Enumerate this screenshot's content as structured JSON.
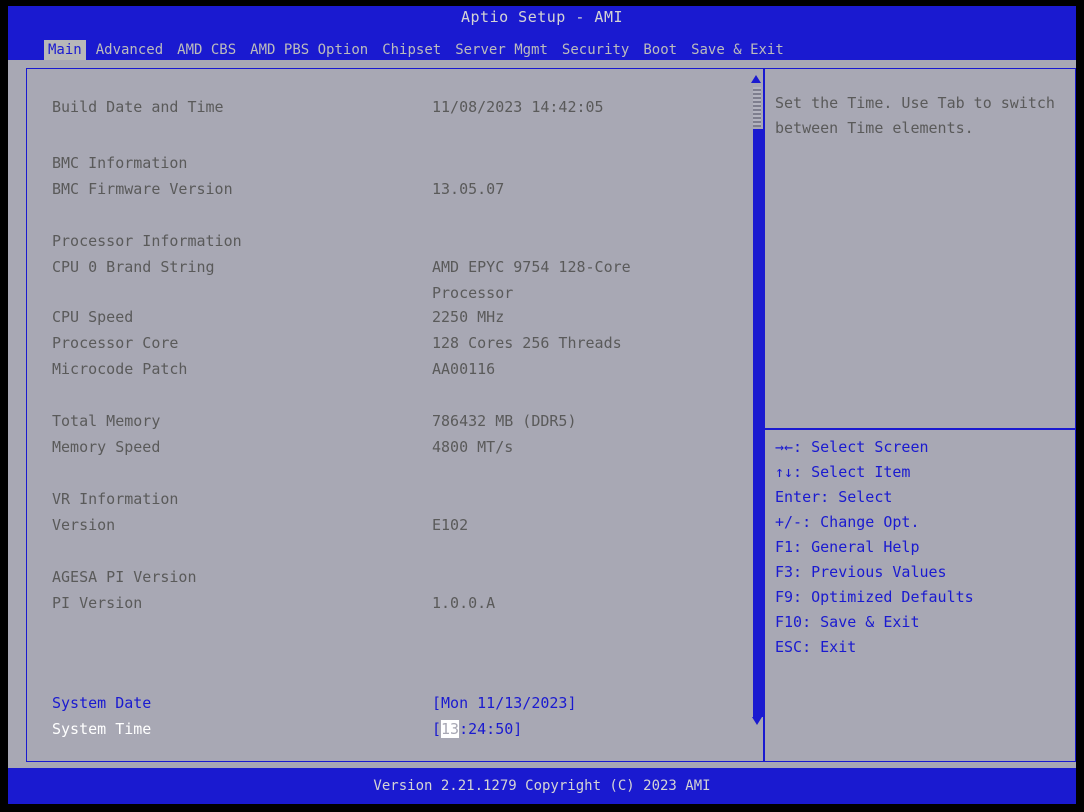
{
  "window": {
    "title": "Aptio Setup - AMI"
  },
  "tabs": [
    "Main",
    "Advanced",
    "AMD CBS",
    "AMD PBS Option",
    "Chipset",
    "Server Mgmt",
    "Security",
    "Boot",
    "Save & Exit"
  ],
  "main": {
    "build_label": "Build Date and Time",
    "build_value": "11/08/2023 14:42:05",
    "bmc_heading": "BMC Information",
    "bmc_fw_label": "BMC Firmware Version",
    "bmc_fw_value": "13.05.07",
    "proc_heading": "Processor Information",
    "cpu_brand_label": "CPU 0 Brand String",
    "cpu_brand_value_1": "AMD EPYC 9754 128-Core",
    "cpu_brand_value_2": "Processor",
    "cpu_speed_label": "CPU Speed",
    "cpu_speed_value": "2250 MHz",
    "proc_core_label": "Processor Core",
    "proc_core_value": "128 Cores 256 Threads",
    "microcode_label": "Microcode Patch",
    "microcode_value": "AA00116",
    "mem_total_label": "Total Memory",
    "mem_total_value": "786432 MB (DDR5)",
    "mem_speed_label": "Memory Speed",
    "mem_speed_value": "4800 MT/s",
    "vr_heading": "VR Information",
    "vr_version_label": "Version",
    "vr_version_value": "E102",
    "agesa_heading": "AGESA PI Version",
    "pi_version_label": "PI Version",
    "pi_version_value": "1.0.0.A",
    "date_label": "System Date",
    "date_value": "[Mon 11/13/2023]",
    "time_label": "System Time",
    "time_bracket_open": "[",
    "time_cursor": "13",
    "time_rest": ":24:50]"
  },
  "help": {
    "text": "Set the Time. Use Tab to switch between Time elements.",
    "keys": [
      "→←: Select Screen",
      "↑↓: Select Item",
      "Enter: Select",
      "+/-: Change Opt.",
      "F1: General Help",
      "F3: Previous Values",
      "F9: Optimized Defaults",
      "F10: Save & Exit",
      "ESC: Exit"
    ]
  },
  "footer": {
    "text": "Version 2.21.1279 Copyright (C) 2023 AMI"
  },
  "colors": {
    "accent": "#1a1ad0",
    "panel": "#a8a8b4",
    "text": "#5a5a5a"
  }
}
